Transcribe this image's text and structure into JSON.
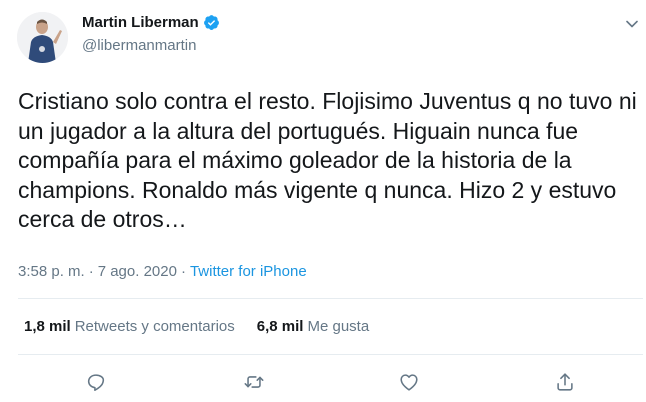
{
  "author": {
    "display_name": "Martin Liberman",
    "handle": "@libermanmartin"
  },
  "tweet": {
    "text": "Cristiano solo contra el resto. Flojisimo Juventus q no tuvo ni un jugador a la altura del portugués. Higuain nunca fue compañía para el máximo goleador de la historia de la champions. Ronaldo más vigente q nunca. Hizo 2 y estuvo cerca de otros…"
  },
  "meta": {
    "time": "3:58 p. m.",
    "separator": "·",
    "date": "7 ago. 2020",
    "source": "Twitter for iPhone"
  },
  "stats": {
    "retweets_count": "1,8 mil",
    "retweets_label": "Retweets y comentarios",
    "likes_count": "6,8 mil",
    "likes_label": "Me gusta"
  },
  "icons": {
    "verified": "verified-badge-icon",
    "menu": "chevron-down-icon",
    "reply": "reply-icon",
    "retweet": "retweet-icon",
    "like": "heart-icon",
    "share": "share-icon"
  },
  "colors": {
    "text": "#14171a",
    "secondary": "#657786",
    "accent": "#1b95e0",
    "divider": "#e6ecf0"
  }
}
